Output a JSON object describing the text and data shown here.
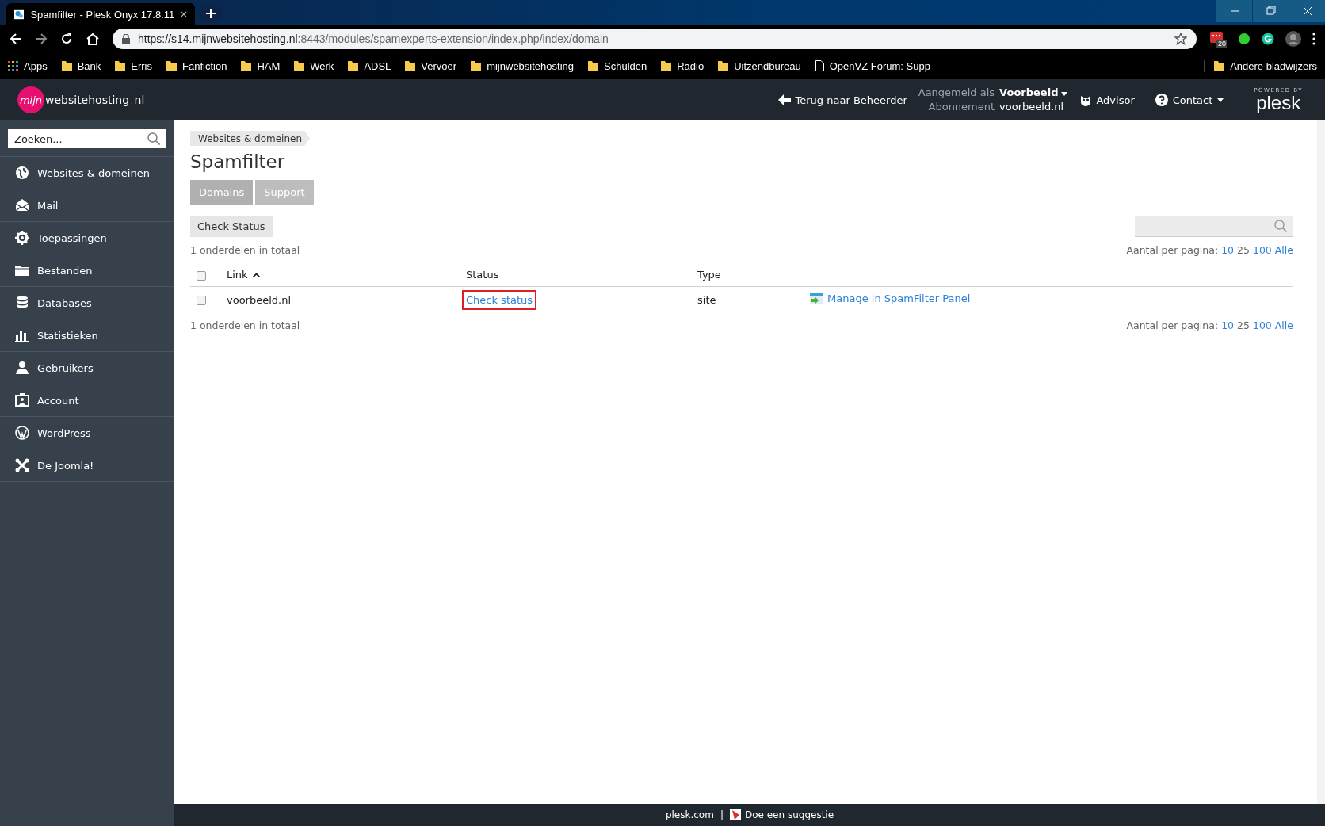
{
  "browser": {
    "tab_title": "Spamfilter - Plesk Onyx 17.8.11",
    "url_host": "https://s14.mijnwebsitehosting.nl",
    "url_path": ":8443/modules/spamexperts-extension/index.php/index/domain",
    "extension_badge": "20",
    "bookmarks": [
      {
        "label": "Apps",
        "kind": "apps"
      },
      {
        "label": "Bank",
        "kind": "folder"
      },
      {
        "label": "Erris",
        "kind": "folder"
      },
      {
        "label": "Fanfiction",
        "kind": "folder"
      },
      {
        "label": "HAM",
        "kind": "folder"
      },
      {
        "label": "Werk",
        "kind": "folder"
      },
      {
        "label": "ADSL",
        "kind": "folder"
      },
      {
        "label": "Vervoer",
        "kind": "folder"
      },
      {
        "label": "mijnwebsitehosting",
        "kind": "folder"
      },
      {
        "label": "Schulden",
        "kind": "folder"
      },
      {
        "label": "Radio",
        "kind": "folder"
      },
      {
        "label": "Uitzendbureau",
        "kind": "folder"
      },
      {
        "label": "OpenVZ Forum: Supp",
        "kind": "page"
      }
    ],
    "other_bookmarks": "Andere bladwijzers"
  },
  "header": {
    "logo_badge": "mijn",
    "logo_text": "websitehosting",
    "logo_tld": ".nl",
    "back_link": "Terug naar Beheerder",
    "logged_in_label": "Aangemeld als",
    "logged_in_user": "Voorbeeld",
    "subscription_label": "Abonnement",
    "subscription": "voorbeeld.nl",
    "advisor": "Advisor",
    "contact": "Contact",
    "powered_by": "POWERED BY",
    "plesk": "plesk"
  },
  "sidebar": {
    "search_placeholder": "Zoeken...",
    "items": [
      {
        "label": "Websites & domeinen",
        "kind": "globe"
      },
      {
        "label": "Mail",
        "kind": "mail"
      },
      {
        "label": "Toepassingen",
        "kind": "gear"
      },
      {
        "label": "Bestanden",
        "kind": "folder"
      },
      {
        "label": "Databases",
        "kind": "database"
      },
      {
        "label": "Statistieken",
        "kind": "chart"
      },
      {
        "label": "Gebruikers",
        "kind": "user"
      },
      {
        "label": "Account",
        "kind": "account"
      },
      {
        "label": "WordPress",
        "kind": "wordpress"
      },
      {
        "label": "De Joomla!",
        "kind": "joomla"
      }
    ]
  },
  "breadcrumb": "Websites & domeinen",
  "title": "Spamfilter",
  "tabs": [
    {
      "label": "Domains",
      "selected": true
    },
    {
      "label": "Support",
      "selected": false
    }
  ],
  "toolbar_button": "Check Status",
  "list": {
    "total_top": "1 onderdelen in totaal",
    "total_bottom": "1 onderdelen in totaal",
    "pagination_top": {
      "label": "Aantal per pagina:",
      "options": [
        {
          "label": "10",
          "selected": false
        },
        {
          "label": "25",
          "selected": true
        },
        {
          "label": "100",
          "selected": false
        },
        {
          "label": "Alle",
          "selected": false
        }
      ]
    },
    "pagination_bottom": {
      "label": "Aantal per pagina:",
      "options": [
        {
          "label": "10",
          "selected": false
        },
        {
          "label": "25",
          "selected": true
        },
        {
          "label": "100",
          "selected": false
        },
        {
          "label": "Alle",
          "selected": false
        }
      ]
    },
    "select_all_checked": false,
    "columns": [
      {
        "label": "Link",
        "sorted": true
      },
      {
        "label": "Status",
        "sorted": false
      },
      {
        "label": "Type",
        "sorted": false
      }
    ],
    "rows": [
      {
        "link": "voorbeeld.nl",
        "checked": false,
        "status": "Check status",
        "status_highlighted": true,
        "type": "site",
        "action": "Manage in SpamFilter Panel"
      }
    ]
  },
  "footer": {
    "link": "plesk.com",
    "separator": "|",
    "suggest": "Doe een suggestie"
  }
}
